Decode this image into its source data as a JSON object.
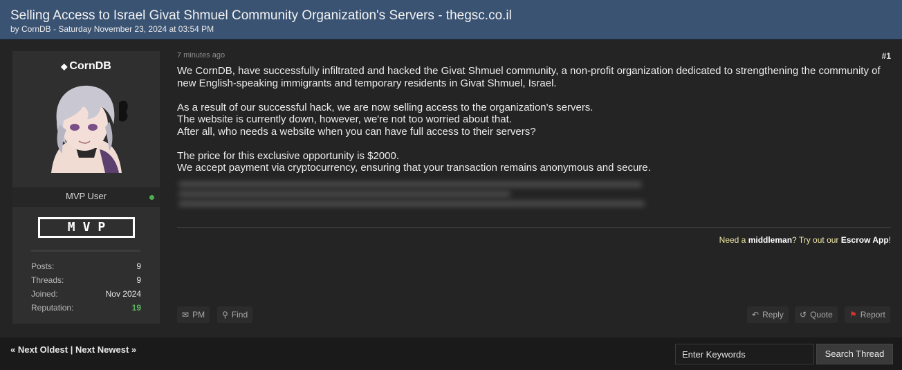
{
  "thread": {
    "title": "Selling Access to Israel Givat Shmuel Community Organization's Servers - thegsc.co.il",
    "byline": "by CornDB - Saturday November 23, 2024 at 03:54 PM"
  },
  "author": {
    "username": "CornDB",
    "username_icon": "diamond-icon",
    "role": "MVP User",
    "badge": "MVP",
    "stats": [
      {
        "label": "Posts:",
        "value": "9"
      },
      {
        "label": "Threads:",
        "value": "9"
      },
      {
        "label": "Joined:",
        "value": "Nov 2024"
      },
      {
        "label": "Reputation:",
        "value": "19"
      }
    ],
    "online_color": "#4caf50"
  },
  "post": {
    "time_ago": "7 minutes ago",
    "number": "#1",
    "paragraphs": [
      [
        "We CornDB, have successfully infiltrated and hacked the Givat Shmuel community, a non-profit organization dedicated to strengthening the community of new English-speaking immigrants and temporary residents in Givat Shmuel, Israel."
      ],
      [
        "As a result of our successful hack, we are now selling access to the organization's servers.",
        "The website is currently down, however, we're not too worried about that.",
        "After all, who needs a website when you can have full access to their servers?"
      ],
      [
        "The price for this exclusive opportunity is $2000.",
        "We accept payment via cryptocurrency, ensuring that your transaction remains anonymous and secure."
      ]
    ],
    "escrow": {
      "pre": "Need a ",
      "middleman": "middleman",
      "mid": "? Try out our ",
      "app": "Escrow App",
      "post": "!"
    },
    "buttons": {
      "pm": "PM",
      "find": "Find",
      "reply": "Reply",
      "quote": "Quote",
      "report": "Report"
    }
  },
  "footer": {
    "next_oldest": "« Next Oldest",
    "separator": "|",
    "next_newest": "Next Newest »",
    "search_placeholder": "Enter Keywords",
    "search_button": "Search Thread"
  },
  "colors": {
    "header_bg": "#3a5373",
    "reputation": "#5cb85c",
    "report_flag": "#d9342b"
  }
}
